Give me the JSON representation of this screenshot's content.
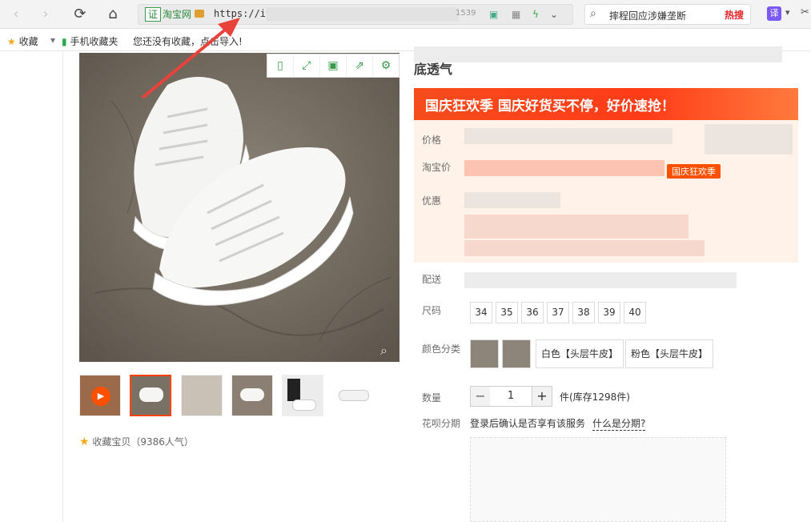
{
  "browser": {
    "cert_label": "证",
    "site_name": "淘宝网",
    "url_prefix": "https://it",
    "url_fragment": "1539",
    "search_text": "摔程回应涉嫌垄断",
    "hot_label": "热搜",
    "translate_label": "译"
  },
  "bookmarks": {
    "fav_label": "收藏",
    "mobile_label": "手机收藏夹",
    "hint": "您还没有收藏，点击导入!"
  },
  "product": {
    "title_line2": "底透气",
    "promo_tag": "国庆狂欢季 国庆好货买不停，好价速抢！",
    "price_label": "价格",
    "taobao_price_label": "淘宝价",
    "festival_badge": "国庆狂欢季",
    "discount_label": "优惠",
    "delivery_label": "配送",
    "size_label": "尺码",
    "sizes": [
      "34",
      "35",
      "36",
      "37",
      "38",
      "39",
      "40"
    ],
    "color_label": "颜色分类",
    "colors": [
      "白色【头层牛皮】",
      "粉色【头层牛皮】"
    ],
    "qty_label": "数量",
    "qty_value": "1",
    "stock_text": "件(库存1298件)",
    "huabei_label": "花呗分期",
    "huabei_text": "登录后确认是否享有该服务",
    "huabei_link": "什么是分期?",
    "favorite_text": "收藏宝贝（9386人气）"
  },
  "colors": {
    "accent": "#ff5000",
    "promo_bg": "#f64c1c",
    "price_bg": "#fff2e8"
  }
}
